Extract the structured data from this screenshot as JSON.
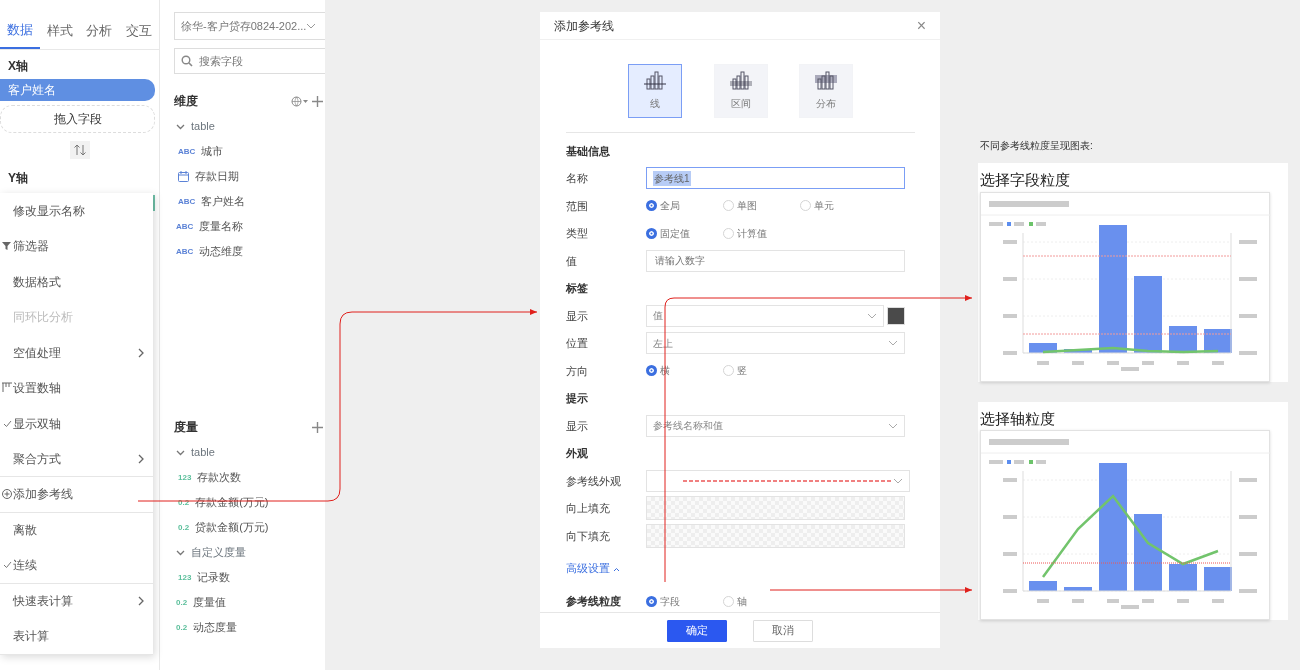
{
  "left_panel": {
    "tabs": [
      {
        "label": "数据",
        "selected": true
      },
      {
        "label": "样式",
        "selected": false
      },
      {
        "label": "分析",
        "selected": false
      },
      {
        "label": "交互",
        "selected": false
      }
    ],
    "x_axis": {
      "label": "X轴",
      "field": "客户姓名",
      "drop_hint": "拖入字段"
    },
    "y_axis": {
      "label": "Y轴"
    },
    "context_menu": [
      {
        "label": "修改显示名称",
        "kind": "plain",
        "checked": false,
        "disabled": false,
        "submenu": false,
        "divider": false
      },
      {
        "label": "筛选器",
        "kind": "filter",
        "checked": false,
        "disabled": false,
        "submenu": false,
        "divider": false
      },
      {
        "label": "数据格式",
        "kind": "plain",
        "checked": false,
        "disabled": false,
        "submenu": false,
        "divider": false
      },
      {
        "label": "同环比分析",
        "kind": "plain",
        "checked": false,
        "disabled": true,
        "submenu": false,
        "divider": false
      },
      {
        "label": "空值处理",
        "kind": "plain",
        "checked": false,
        "disabled": false,
        "submenu": true,
        "divider": false
      },
      {
        "label": "设置数轴",
        "kind": "axis",
        "checked": false,
        "disabled": false,
        "submenu": false,
        "divider": false
      },
      {
        "label": "显示双轴",
        "kind": "plain",
        "checked": true,
        "disabled": false,
        "submenu": false,
        "divider": false
      },
      {
        "label": "聚合方式",
        "kind": "plain",
        "checked": false,
        "disabled": false,
        "submenu": true,
        "divider": true
      },
      {
        "label": "添加参考线",
        "kind": "add",
        "checked": false,
        "disabled": false,
        "submenu": false,
        "divider": true
      },
      {
        "label": "离散",
        "kind": "plain",
        "checked": false,
        "disabled": false,
        "submenu": false,
        "divider": false
      },
      {
        "label": "连续",
        "kind": "plain",
        "checked": true,
        "disabled": false,
        "submenu": false,
        "divider": true
      },
      {
        "label": "快速表计算",
        "kind": "plain",
        "checked": false,
        "disabled": false,
        "submenu": true,
        "divider": false
      },
      {
        "label": "表计算",
        "kind": "plain",
        "checked": false,
        "disabled": false,
        "submenu": false,
        "divider": true
      }
    ]
  },
  "data_panel": {
    "dataset": "徐华-客户贷存0824-202...",
    "search": {
      "placeholder": "搜索字段"
    },
    "dimensions": {
      "title": "维度",
      "items": [
        {
          "name": "table",
          "kind": "folder",
          "expanded": true,
          "children": [
            {
              "name": "城市",
              "kind": "text",
              "type_label": "ABC"
            },
            {
              "name": "存款日期",
              "kind": "date"
            },
            {
              "name": "客户姓名",
              "kind": "text",
              "type_label": "ABC"
            }
          ]
        },
        {
          "name": "度量名称",
          "kind": "text",
          "type_label": "ABC"
        },
        {
          "name": "动态维度",
          "kind": "text",
          "type_label": "ABC"
        }
      ]
    },
    "measures": {
      "title": "度量",
      "items": [
        {
          "name": "table",
          "kind": "folder",
          "expanded": true,
          "children": [
            {
              "name": "存款次数",
              "kind": "number",
              "type_label": "123"
            },
            {
              "name": "存款金额(万元)",
              "kind": "number",
              "type_label": "0.2"
            },
            {
              "name": "贷款金额(万元)",
              "kind": "number",
              "type_label": "0.2"
            }
          ]
        },
        {
          "name": "自定义度量",
          "kind": "folder",
          "expanded": true,
          "children": [
            {
              "name": "记录数",
              "kind": "number",
              "type_label": "123"
            }
          ]
        },
        {
          "name": "度量值",
          "kind": "number",
          "type_label": "0.2"
        },
        {
          "name": "动态度量",
          "kind": "number",
          "type_label": "0.2"
        }
      ]
    }
  },
  "dialog": {
    "title": "添加参考线",
    "close": "×",
    "types": [
      {
        "label": "线",
        "selected": true
      },
      {
        "label": "区间",
        "selected": false
      },
      {
        "label": "分布",
        "selected": false
      }
    ],
    "rows": [
      {
        "kind": "section",
        "label": "基础信息"
      },
      {
        "kind": "input",
        "label": "名称",
        "value": "参考线1"
      },
      {
        "kind": "radio",
        "label": "范围",
        "options": [
          {
            "label": "全局",
            "selected": true
          },
          {
            "label": "单图",
            "selected": false
          },
          {
            "label": "单元",
            "selected": false
          }
        ]
      },
      {
        "kind": "radio",
        "label": "类型",
        "options": [
          {
            "label": "固定值",
            "selected": true
          },
          {
            "label": "计算值",
            "selected": false
          }
        ]
      },
      {
        "kind": "input",
        "label": "值",
        "placeholder": "请输入数字"
      },
      {
        "kind": "section",
        "label": "标签"
      },
      {
        "kind": "select_color",
        "label": "显示",
        "value": "值",
        "color": "#4a4a4a"
      },
      {
        "kind": "select",
        "label": "位置",
        "value": "左上"
      },
      {
        "kind": "radio",
        "label": "方向",
        "options": [
          {
            "label": "横",
            "selected": true
          },
          {
            "label": "竖",
            "selected": false
          }
        ]
      },
      {
        "kind": "section",
        "label": "提示"
      },
      {
        "kind": "select",
        "label": "显示",
        "value": "参考线名称和值"
      },
      {
        "kind": "section",
        "label": "外观"
      },
      {
        "kind": "line_style",
        "label": "参考线外观",
        "color": "#f08080"
      },
      {
        "kind": "fill",
        "label": "向上填充"
      },
      {
        "kind": "fill",
        "label": "向下填充"
      },
      {
        "kind": "link",
        "label": "高级设置",
        "expanded": true
      },
      {
        "kind": "radio",
        "label": "参考线粒度",
        "bold": true,
        "options": [
          {
            "label": "字段",
            "selected": true
          },
          {
            "label": "轴",
            "selected": false
          }
        ]
      }
    ],
    "buttons": [
      {
        "label": "确定",
        "kind": "primary"
      },
      {
        "label": "取消",
        "kind": "secondary"
      }
    ]
  },
  "notes": {
    "caption": "不同参考线粒度呈现图表:",
    "images": [
      {
        "heading": "选择字段粒度"
      },
      {
        "heading": "选择轴粒度"
      }
    ]
  }
}
